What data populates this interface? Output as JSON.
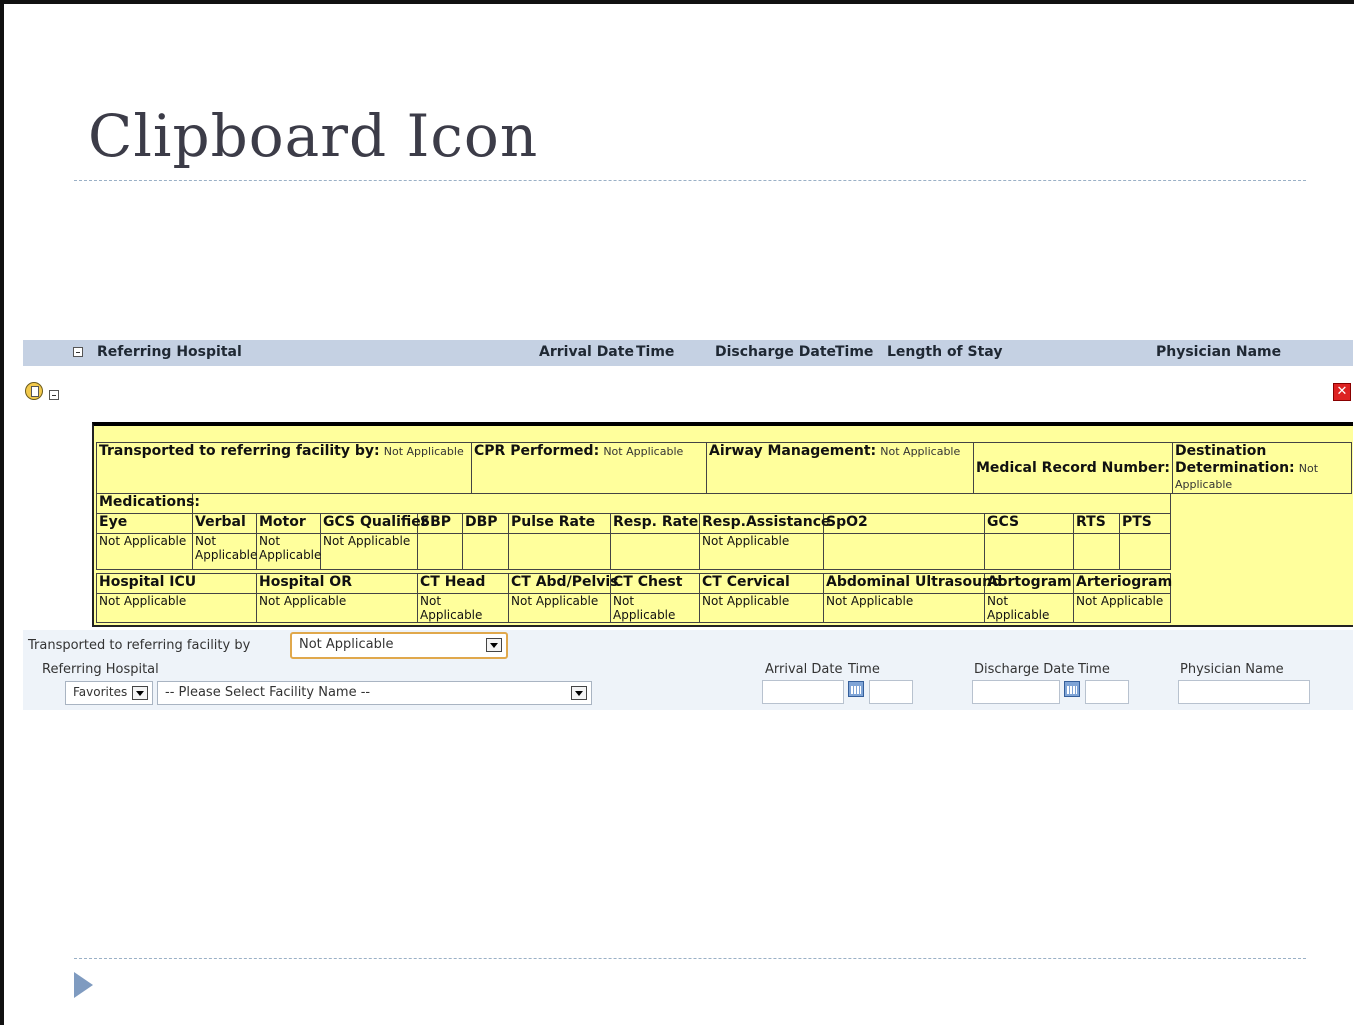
{
  "slide": {
    "title": "Clipboard Icon"
  },
  "header_bar": {
    "referring_hospital": "Referring Hospital",
    "arrival_date": "Arrival Date",
    "arrival_time": "Time",
    "discharge_date": "Discharge Date",
    "discharge_time": "Time",
    "length_of_stay": "Length of Stay",
    "physician_name": "Physician Name"
  },
  "icons": {
    "clipboard": "clipboard-icon",
    "collapse": "minus-icon",
    "close": "close-icon",
    "calendar": "calendar-icon"
  },
  "colors": {
    "header_bar": "#c5d1e3",
    "detail_bg": "#ffff9c",
    "form_bg": "#eef3f9",
    "close_red": "#dd2222"
  },
  "details": {
    "transported_label": "Transported to referring facility by:",
    "transported_value": "Not Applicable",
    "cpr_label": "CPR Performed:",
    "cpr_value": "Not Applicable",
    "airway_label": "Airway Management:",
    "airway_value": "Not Applicable",
    "mrn_label": "Medical Record Number:",
    "destination_label": "Destination Determination:",
    "destination_value": "Not Applicable",
    "medications_label": "Medications:",
    "vitals_headers": [
      "Eye",
      "Verbal",
      "Motor",
      "GCS Qualifier",
      "SBP",
      "DBP",
      "Pulse Rate",
      "Resp. Rate",
      "Resp.Assistance",
      "SpO2",
      "GCS",
      "RTS",
      "PTS"
    ],
    "vitals_values": [
      "Not Applicable",
      "Not Applicable",
      "Not Applicable",
      "Not Applicable",
      "",
      "",
      "",
      "",
      "Not Applicable",
      "",
      "",
      "",
      ""
    ],
    "proc_headers": [
      "Hospital ICU",
      "Hospital OR",
      "CT Head",
      "CT Abd/Pelvis",
      "CT Chest",
      "CT Cervical",
      "Abdominal Ultrasound",
      "Aortogram",
      "Arteriogram"
    ],
    "proc_values": [
      "Not Applicable",
      "Not Applicable",
      "Not Applicable",
      "Not Applicable",
      "Not Applicable",
      "Not Applicable",
      "Not Applicable",
      "Not Applicable",
      "Not Applicable"
    ]
  },
  "form": {
    "transported_label": "Transported to referring facility by",
    "transported_value": "Not Applicable",
    "referring_label": "Referring Hospital",
    "favorites_value": "Favorites",
    "facility_value": "-- Please Select Facility Name --",
    "arrival_date_label": "Arrival Date",
    "arrival_time_label": "Time",
    "discharge_date_label": "Discharge Date",
    "discharge_time_label": "Time",
    "physician_label": "Physician Name"
  }
}
